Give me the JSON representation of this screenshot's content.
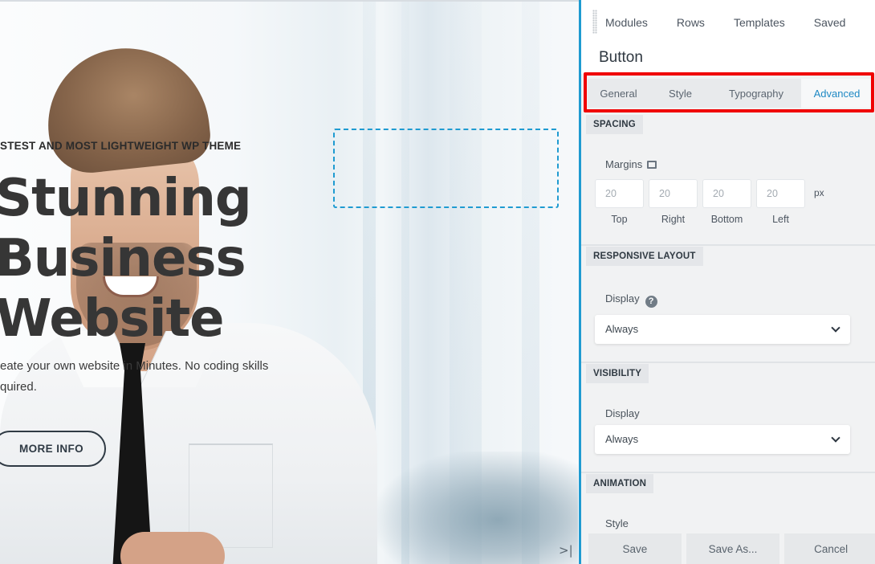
{
  "hero": {
    "eyebrow": "STEST AND MOST LIGHTWEIGHT WP THEME",
    "title_line1": "Stunning",
    "title_line2": "Business",
    "title_line3": "Website",
    "description": "eate your own website in Minutes. No coding skills quired.",
    "more_info_label": "MORE INFO",
    "collapse_icon": ">|"
  },
  "panel": {
    "top_tabs": [
      "Modules",
      "Rows",
      "Templates",
      "Saved"
    ],
    "title": "Button",
    "sub_tabs": [
      "General",
      "Style",
      "Typography",
      "Advanced"
    ],
    "active_sub_tab": "Advanced",
    "spacing": {
      "section_label": "SPACING",
      "margins_label": "Margins",
      "unit": "px",
      "fields": [
        {
          "placeholder": "20",
          "label": "Top"
        },
        {
          "placeholder": "20",
          "label": "Right"
        },
        {
          "placeholder": "20",
          "label": "Bottom"
        },
        {
          "placeholder": "20",
          "label": "Left"
        }
      ]
    },
    "responsive_layout": {
      "section_label": "RESPONSIVE LAYOUT",
      "display_label": "Display",
      "help_glyph": "?",
      "display_value": "Always"
    },
    "visibility": {
      "section_label": "VISIBILITY",
      "display_label": "Display",
      "display_value": "Always"
    },
    "animation": {
      "section_label": "ANIMATION",
      "style_label": "Style"
    },
    "footer": {
      "save": "Save",
      "save_as": "Save As...",
      "cancel": "Cancel"
    }
  },
  "colors": {
    "accent": "#1f9bd1",
    "active_tab_text": "#1f89c4",
    "highlight_border": "#f00000",
    "panel_bg": "#f1f2f3"
  }
}
